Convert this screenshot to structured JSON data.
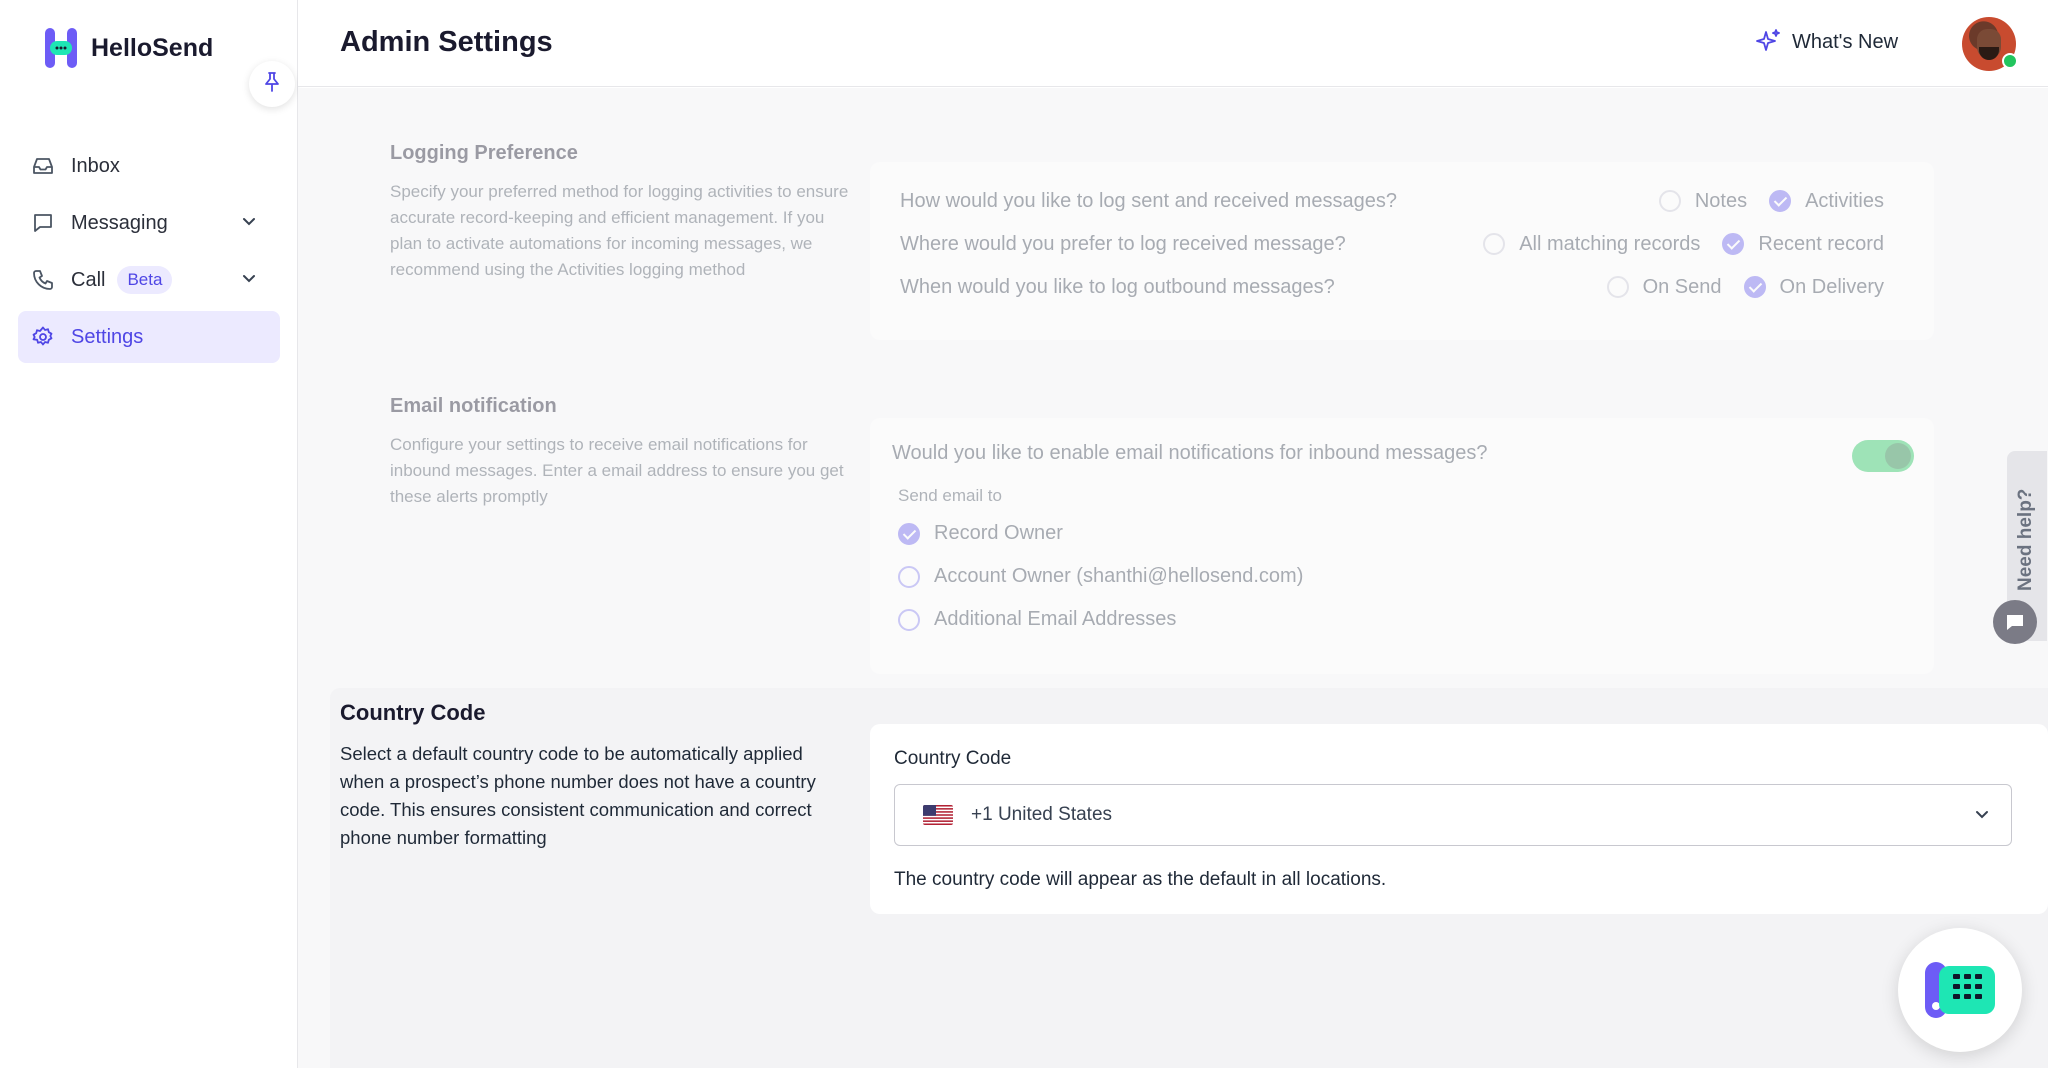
{
  "app": {
    "name": "HelloSend"
  },
  "sidebar": {
    "items": [
      {
        "label": "Inbox",
        "icon": "inbox-icon"
      },
      {
        "label": "Messaging",
        "icon": "message-icon",
        "expandable": true
      },
      {
        "label": "Call",
        "icon": "phone-icon",
        "badge": "Beta",
        "expandable": true
      },
      {
        "label": "Settings",
        "icon": "gear-icon",
        "active": true
      }
    ]
  },
  "header": {
    "title": "Admin Settings",
    "whats_new": "What's New"
  },
  "logging": {
    "title": "Logging Preference",
    "description": "Specify your preferred method for logging activities to ensure accurate record-keeping and efficient management. If you plan to activate automations for incoming messages, we recommend using the Activities logging method",
    "questions": [
      {
        "text": "How would you like to log sent and received messages?",
        "options": [
          {
            "label": "Notes",
            "checked": false
          },
          {
            "label": "Activities",
            "checked": true
          }
        ]
      },
      {
        "text": "Where would you prefer to log received message?",
        "options": [
          {
            "label": "All matching records",
            "checked": false
          },
          {
            "label": "Recent record",
            "checked": true
          }
        ]
      },
      {
        "text": "When would you like to log outbound messages?",
        "options": [
          {
            "label": "On Send",
            "checked": false
          },
          {
            "label": "On Delivery",
            "checked": true
          }
        ]
      }
    ]
  },
  "email_notification": {
    "title": "Email notification",
    "description": "Configure your settings to receive email notifications for inbound messages. Enter a email address to ensure you get these alerts promptly",
    "question": "Would you like to enable email notifications for inbound messages?",
    "enabled": true,
    "send_to_label": "Send email to",
    "recipients": [
      {
        "label": "Record Owner",
        "checked": true
      },
      {
        "label": "Account Owner (shanthi@hellosend.com)",
        "checked": false
      },
      {
        "label": "Additional Email Addresses",
        "checked": false
      }
    ]
  },
  "country_code": {
    "title": "Country Code",
    "description": "Select a default country code to be automatically applied when a prospect’s phone number does not have a country code. This ensures consistent communication and correct phone number formatting",
    "field_label": "Country Code",
    "selected": "+1 United States",
    "helper": "The country code will appear as the default in all locations."
  },
  "help": {
    "label": "Need help?"
  },
  "colors": {
    "accent": "#4f46e5",
    "active_bg": "#eceaff",
    "toggle_on": "#22c55e",
    "brand_green": "#1ee6b4"
  }
}
